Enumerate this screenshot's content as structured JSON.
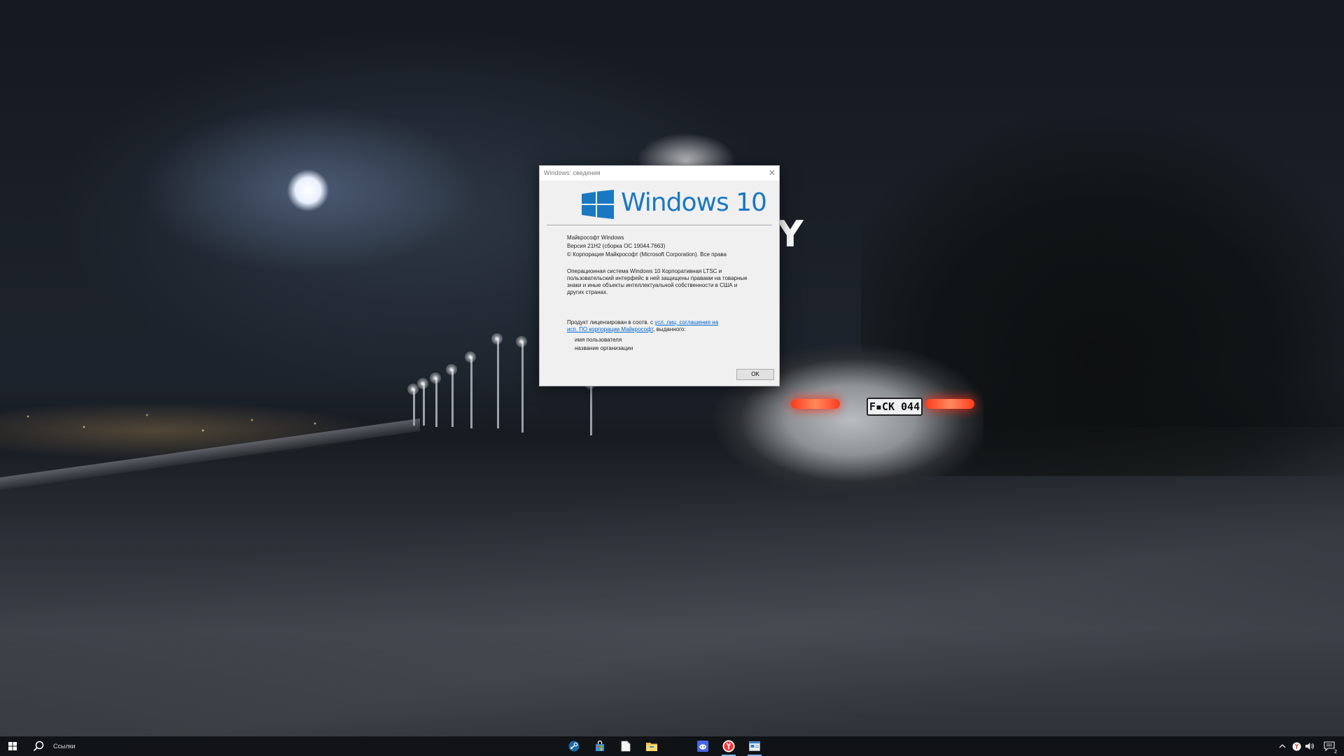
{
  "dialog": {
    "title": "Windows: сведения",
    "brand": "Windows 10",
    "lines_block_1": [
      "Майкрософт Windows",
      "Версия 21H2 (сборка ОС 19044.7663)",
      "© Корпорация Майкрософт (Microsoft Corporation). Все права"
    ],
    "lines_block_2": [
      "Операционная система Windows 10 Корпоративная LTSC и",
      "пользовательский интерфейс в ней защищены правами на товарные",
      "знаки и иные объекты интеллектуальной собственности в США и",
      "других странах."
    ],
    "license_prefix": "Продукт лицензирован в соотв. с ",
    "license_link_line1": "усл. лиц. соглашения на",
    "license_link_line2": "исп. ПО корпорации Майкрософт",
    "license_suffix": ", выданного:",
    "user_name": "имя пользователя",
    "org_name": "название организации",
    "ok_label": "OK",
    "close_label": "✕"
  },
  "wallpaper": {
    "plate_text": "F▪CK 044",
    "glyph": "Y"
  },
  "taskbar": {
    "links_label": "Ссылки",
    "apps": [
      {
        "name": "steam-icon",
        "active": false
      },
      {
        "name": "store-icon",
        "active": false
      },
      {
        "name": "notepad-icon",
        "active": false
      },
      {
        "name": "file-explorer-icon",
        "active": false
      },
      {
        "name": "discord-icon",
        "active": false
      },
      {
        "name": "yandex-browser-icon",
        "active": true
      },
      {
        "name": "winver-window-icon",
        "active": true
      }
    ],
    "tray": [
      "chevron-up-icon",
      "yandex-tray-icon",
      "volume-icon",
      "notifications-icon"
    ],
    "notification_count": "2"
  },
  "colors": {
    "windows_blue": "#1a78c2",
    "link_blue": "#0066cc",
    "dialog_bg": "#f0f0f0",
    "taskbar_bg": "#0e1014"
  }
}
